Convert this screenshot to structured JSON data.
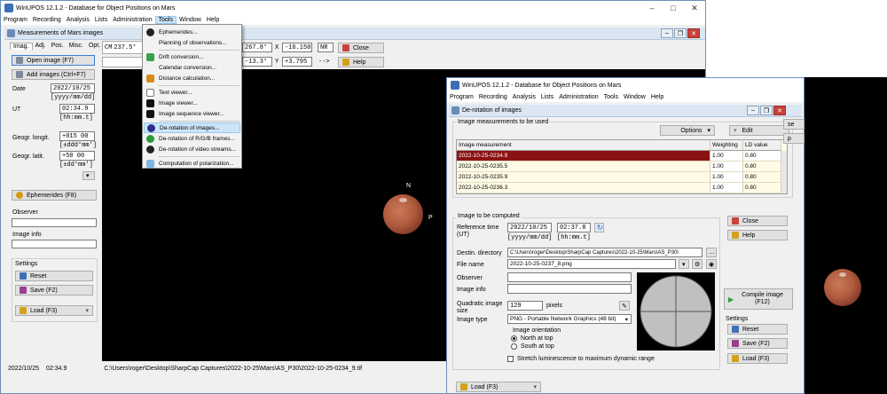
{
  "main_window": {
    "title": "WinUPOS 12.1.2 - Database for Object Positions on Mars",
    "menu": [
      "Program",
      "Recording",
      "Analysis",
      "Lists",
      "Administration",
      "Tools",
      "Window",
      "Help"
    ],
    "active_menu": "Tools"
  },
  "measurements_panel": {
    "title": "Measurements of Mars images",
    "tabs": [
      "Imag.",
      "Adj.",
      "Pos.",
      "Misc.",
      "Opt."
    ],
    "open_image": "Open image (F7)",
    "add_images": "Add images (Ctrl+F7)",
    "date_label": "Date",
    "date_value": "2022/10/25",
    "date_format": "[yyyy/mm/dd]",
    "ut_label": "UT",
    "ut_value": "02:34.9",
    "ut_format": "[hh:mm.t]",
    "lon_label": "Geogr. longit.",
    "lon_value": "+015 00",
    "lon_format": "[±ddd°mm']",
    "lat_label": "Geogr. latit.",
    "lat_value": "+50 00",
    "lat_format": "[±dd°mm']",
    "ephemerides_btn": "Ephemerides (F8)",
    "observer_label": "Observer",
    "image_info_label": "Image info",
    "settings_label": "Settings",
    "reset_btn": "Reset",
    "save_btn": "Save (F2)",
    "load_btn": "Load (F3)"
  },
  "top_strip": {
    "cm_label": "CM",
    "cm_value": "237.5°",
    "field_a": "267.8°",
    "x_label": "X",
    "x_value": "-16.150",
    "nr_label": "NR",
    "close_btn": "Close",
    "field_b": "-13.3°",
    "y_label": "Y",
    "y_value": "+3.795",
    "arrow_label": "-->",
    "help_btn": "Help"
  },
  "status_bar": {
    "date": "2022/10/25",
    "time": "02:34.9",
    "path": "C:\\Users\\roger\\Desktop\\SharpCap Captures\\2022-10-25\\Mars\\AS_P30\\2022-10-25-0234_9.tif"
  },
  "tools_menu": {
    "items": [
      "Ephemerides...",
      "Planning of observations...",
      "Drift conversion...",
      "Calendar conversion...",
      "Distance calculation...",
      "Text viewer...",
      "Image viewer...",
      "Image sequence viewer...",
      "De-rotation of images...",
      "De-rotation of R/G/B frames...",
      "De-rotation of video streams...",
      "Computation of polarization..."
    ],
    "selected": "De-rotation of images..."
  },
  "planet_labels": {
    "north": "N",
    "p": "P"
  },
  "derot_window": {
    "title": "WinUPOS 12.1.2 - Database for Object Positions on Mars",
    "menu": [
      "Program",
      "Recording",
      "Analysis",
      "Lists",
      "Administration",
      "Tools",
      "Window",
      "Help"
    ],
    "dialog_title": "De-rotation of images",
    "group_measurements": "Image measurements to be used",
    "options_btn": "Options",
    "edit_btn": "Edit",
    "table_headers": [
      "Image measurement",
      "Weighting",
      "LD value"
    ],
    "table_rows": [
      [
        "2022-10-25-0234.9",
        "1.00",
        "0.80"
      ],
      [
        "2022-10-25-0235.5",
        "1.00",
        "0.80"
      ],
      [
        "2022-10-25-0235.9",
        "1.00",
        "0.80"
      ],
      [
        "2022-10-25-0236.3",
        "1.00",
        "0.80"
      ]
    ],
    "group_image": "Image to be computed",
    "ref_time_label": "Reference time (UT)",
    "ref_date": "2022/10/25",
    "ref_time": "02:37.8",
    "ref_date_format": "[yyyy/mm/dd]",
    "ref_time_format": "[hh:mm.t]",
    "dest_dir_label": "Destin. directory",
    "dest_dir_value": "C:\\Users\\roger\\Desktop\\SharpCap Captures\\2022-10-25\\Mars\\AS_P30\\",
    "file_name_label": "File name",
    "file_name_value": "2022-10-25-0237_8.png",
    "observer_label": "Observer",
    "image_info_label": "Image info",
    "quad_size_label": "Quadratic image size",
    "quad_size_value": "129",
    "pixels_label": "pixels",
    "image_type_label": "Image type",
    "image_type_value": "PNG  - Portable Network Graphics (48 bit)",
    "orientation_label": "Image orientation",
    "north_top": "North at top",
    "south_top": "South at top",
    "stretch_label": "Stretch luminescence to maximum dynamic range",
    "close_btn": "Close",
    "help_btn": "Help",
    "compile_btn_line1": "Compile image",
    "compile_btn_line2": "(F12)",
    "settings_label": "Settings",
    "reset_btn": "Reset",
    "save_btn": "Save (F2)",
    "load_btn": "Load (F3)",
    "behind_load_btn": "Load (F3)",
    "edge_text_1": "se",
    "edge_text_2": "p"
  }
}
